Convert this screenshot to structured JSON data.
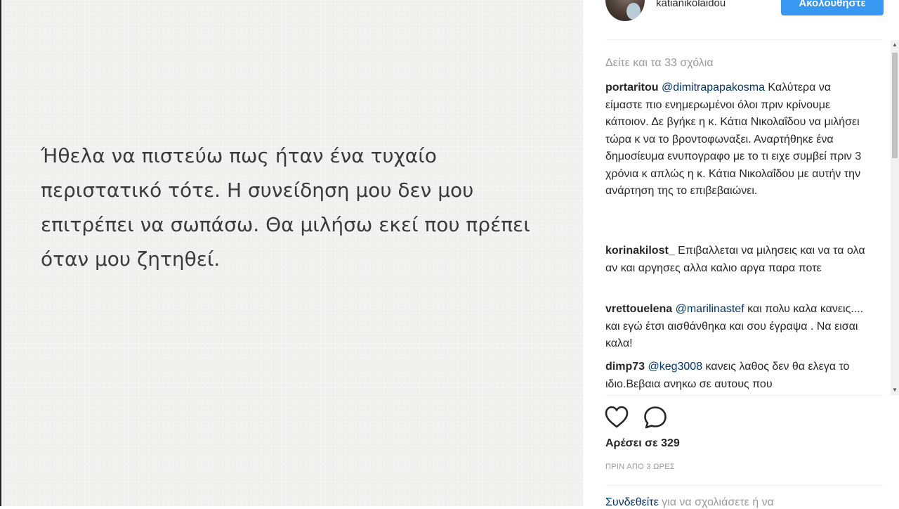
{
  "post": {
    "image_text": "Ήθελα να πιστεύω πως ήταν ένα τυχαίο περιστατικό τότε. Η συνείδηση μου δεν μου επιτρέπει να σωπάσω. Θα μιλήσω εκεί που πρέπει όταν μου ζητηθεί."
  },
  "header": {
    "username": "katianikolaidou",
    "follow_label": "Ακολουθήστε"
  },
  "comments": {
    "load_more": "Δείτε και τα 33 σχόλια",
    "items": [
      {
        "user": "portaritou",
        "mention": "@dimitrapapakosma",
        "text": " Καλύτερα να είμαστε πιο ενημερωμένοι όλοι πριν κρίνουμε κάποιον. Δε βγήκε η κ. Κάτια Νικολαΐδου να μιλήσει τώρα κ να το βροντοφωναξει. Αναρτήθηκε ένα δημοσίευμα ενυπογραφο με το τι ειχε συμβεί πριν 3 χρόνια κ απλώς η κ. Κάτια Νικολαΐδου με αυτήν την ανάρτηση της το επιβεβαιώνει."
      },
      {
        "user": "korinakilost_",
        "mention": "",
        "text": " Επιβαλλεται να μιλησεις και να τα ολα αν και αργησες αλλα καλιο αργα παρα ποτε"
      },
      {
        "user": "vrettouelena",
        "mention": "@marilinastef",
        "text": " και πολυ καλα κανεις.... και εγώ έτσι αισθάνθηκα και σου έγραψα . Να εισαι καλα!"
      },
      {
        "user": "dimp73",
        "mention": "@keg3008",
        "text": " κανεις λαθος δεν θα ελεγα το ιδιο.Βεβαια ανηκω σε αυτους που"
      }
    ]
  },
  "actions": {
    "like_icon": "heart-outline-icon",
    "comment_icon": "speech-bubble-icon"
  },
  "likes_label": "Αρέσει σε 329",
  "timestamp": "ΠΡΙΝ ΑΠΟ 3 ΩΡΕΣ",
  "login_prompt": {
    "link": "Συνδεθείτε",
    "text": " για να σχολιάσετε ή να"
  }
}
